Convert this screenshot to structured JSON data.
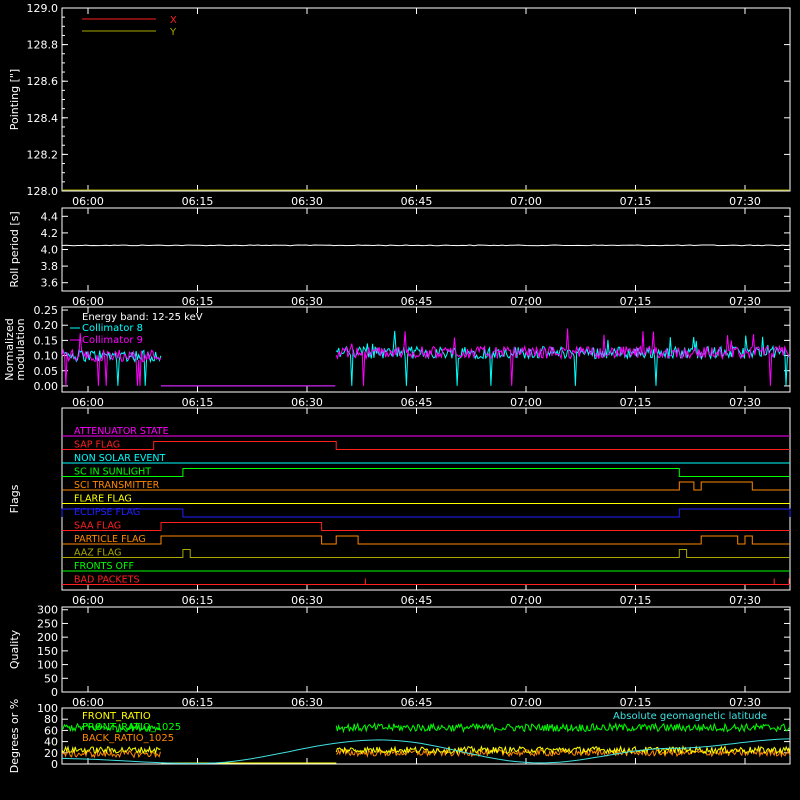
{
  "chart_data": [
    {
      "id": "pointing",
      "type": "line",
      "ylabel": "Pointing [\"]",
      "ylim": [
        128.0,
        129.0
      ],
      "yticks": [
        "129.0",
        "128.8",
        "128.6",
        "128.4",
        "128.2",
        "128.0"
      ],
      "xticks": [
        "06:00",
        "06:15",
        "06:30",
        "06:45",
        "07:00",
        "07:15",
        "07:30"
      ],
      "xlim_hours": [
        5.95,
        7.62
      ],
      "legend_position": "top-left",
      "series": [
        {
          "name": "X",
          "color": "#ff2020",
          "values": []
        },
        {
          "name": "Y",
          "color": "#a8a800",
          "values": []
        }
      ]
    },
    {
      "id": "roll-period",
      "type": "line",
      "ylabel": "Roll period [s]",
      "ylim": [
        3.5,
        4.5
      ],
      "yticks": [
        "4.4",
        "4.2",
        "4.0",
        "3.8",
        "3.6"
      ],
      "xticks": [
        "06:00",
        "06:15",
        "06:30",
        "06:45",
        "07:00",
        "07:15",
        "07:30"
      ],
      "series": [
        {
          "name": "",
          "color": "#ffffff",
          "constant": 4.05
        }
      ]
    },
    {
      "id": "modulation",
      "type": "line",
      "ylabel_lines": [
        "Normalized",
        "modulation"
      ],
      "ylim": [
        -0.02,
        0.26
      ],
      "yticks": [
        "0.25",
        "0.20",
        "0.15",
        "0.10",
        "0.05",
        "0.00"
      ],
      "xticks": [
        "06:00",
        "06:15",
        "06:30",
        "06:45",
        "07:00",
        "07:15",
        "07:30"
      ],
      "legend_title": "Energy band: 12-25 keV",
      "series": [
        {
          "name": "Collimator 8",
          "color": "#00ffff"
        },
        {
          "name": "Collimator 9",
          "color": "#ff00ff"
        }
      ],
      "segments": [
        {
          "t0": "05:55",
          "t1": "06:10",
          "level": 0.1
        },
        {
          "t0": "06:10",
          "t1": "06:34",
          "level": 0.0
        },
        {
          "t0": "06:34",
          "t1": "07:37",
          "level": 0.11
        }
      ]
    },
    {
      "id": "flags",
      "type": "step",
      "ylabel": "Flags",
      "xticks": [
        "06:00",
        "06:15",
        "06:30",
        "06:45",
        "07:00",
        "07:15",
        "07:30"
      ],
      "flags": [
        {
          "name": "ATTENUATOR STATE",
          "color": "#ff00ff",
          "on": []
        },
        {
          "name": "SAP FLAG",
          "color": "#ff2020",
          "on": [
            [
              "06:09",
              "06:34"
            ]
          ]
        },
        {
          "name": "NON SOLAR EVENT",
          "color": "#00ffff",
          "on": []
        },
        {
          "name": "SC IN SUNLIGHT",
          "color": "#00ff00",
          "on": [
            [
              "06:13",
              "07:21"
            ]
          ]
        },
        {
          "name": "SCI TRANSMITTER",
          "color": "#ff8800",
          "on": [
            [
              "07:21",
              "07:23"
            ],
            [
              "07:24",
              "07:31"
            ]
          ]
        },
        {
          "name": "FLARE FLAG",
          "color": "#ffff00",
          "on": []
        },
        {
          "name": "ECLIPSE FLAG",
          "color": "#2020ff",
          "on": [
            [
              "05:55",
              "06:13"
            ],
            [
              "07:21",
              "07:37"
            ]
          ]
        },
        {
          "name": "SAA FLAG",
          "color": "#ff2020",
          "on": [
            [
              "06:10",
              "06:32"
            ]
          ]
        },
        {
          "name": "PARTICLE FLAG",
          "color": "#ff8800",
          "on": [
            [
              "06:10",
              "06:32"
            ],
            [
              "06:34",
              "06:37"
            ],
            [
              "07:24",
              "07:29"
            ],
            [
              "07:30",
              "07:31"
            ]
          ]
        },
        {
          "name": "AAZ FLAG",
          "color": "#a8a800",
          "on": [
            [
              "06:13",
              "06:14"
            ],
            [
              "07:21",
              "07:22"
            ]
          ]
        },
        {
          "name": "FRONTS OFF",
          "color": "#00ff00",
          "on": []
        },
        {
          "name": "BAD PACKETS",
          "color": "#ff2020",
          "spikes": [
            "06:38",
            "07:34",
            "07:37"
          ]
        }
      ]
    },
    {
      "id": "quality",
      "type": "line",
      "ylabel": "Quality",
      "ylim": [
        0,
        310
      ],
      "yticks": [
        "300",
        "250",
        "200",
        "150",
        "100",
        "50",
        "0"
      ],
      "xticks": [
        "06:00",
        "06:15",
        "06:30",
        "06:45",
        "07:00",
        "07:15",
        "07:30"
      ],
      "series": []
    },
    {
      "id": "ratios",
      "type": "line",
      "ylabel": "Degrees or %",
      "ylim": [
        0,
        100
      ],
      "yticks": [
        "100",
        "80",
        "60",
        "40",
        "20",
        "0"
      ],
      "xticks": [
        "06:00",
        "06:15",
        "06:30",
        "06:45",
        "07:00",
        "07:15",
        "07:30"
      ],
      "series": [
        {
          "name": "FRONT_RATIO",
          "color": "#ffff00",
          "level_before_gap": 25,
          "level_after_gap": 25
        },
        {
          "name": "FRONT_RATIO_1025",
          "color": "#00ff00",
          "level_before_gap": 65,
          "level_after_gap": 65
        },
        {
          "name": "BACK_RATIO_1025",
          "color": "#ff8800",
          "level_before_gap": 18,
          "level_after_gap": 20
        },
        {
          "name": "Absolute geomagnetic latitude",
          "color": "#40e0e0"
        }
      ],
      "geomag_latitude_points": [
        [
          "05:55",
          10
        ],
        [
          "06:15",
          1
        ],
        [
          "06:40",
          43
        ],
        [
          "07:02",
          2
        ],
        [
          "07:20",
          28
        ],
        [
          "07:37",
          45
        ]
      ],
      "data_gap": [
        "06:10",
        "06:34"
      ]
    }
  ]
}
